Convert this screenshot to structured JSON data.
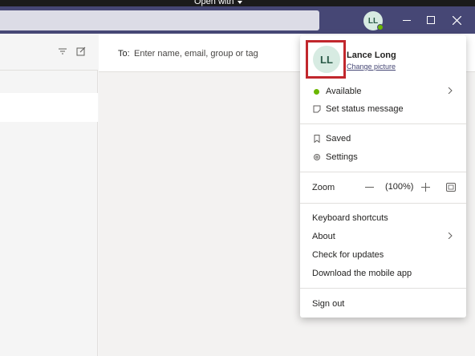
{
  "window": {
    "open_with_label": "Open with",
    "avatar_initials": "LL",
    "title_bar_color": "#464775"
  },
  "compose": {
    "to_label": "To:",
    "to_placeholder": "Enter name, email, group or tag"
  },
  "profile_menu": {
    "avatar_initials": "LL",
    "user_name": "Lance Long",
    "change_picture": "Change picture",
    "status": {
      "label": "Available",
      "color": "#6bb700"
    },
    "set_status": "Set status message",
    "saved": "Saved",
    "settings": "Settings",
    "zoom": {
      "label": "Zoom",
      "value": "(100%)"
    },
    "keyboard_shortcuts": "Keyboard shortcuts",
    "about": "About",
    "check_updates": "Check for updates",
    "download_mobile": "Download the mobile app",
    "sign_out": "Sign out",
    "highlight_color": "#c1272d"
  },
  "icons": [
    "chevron-down-icon",
    "minimize-icon",
    "maximize-icon",
    "close-icon",
    "filter-icon",
    "compose-icon",
    "status-dot-icon",
    "status-message-icon",
    "chevron-right-icon",
    "bookmark-icon",
    "gear-icon",
    "zoom-out-icon",
    "zoom-in-icon",
    "fit-screen-icon"
  ]
}
